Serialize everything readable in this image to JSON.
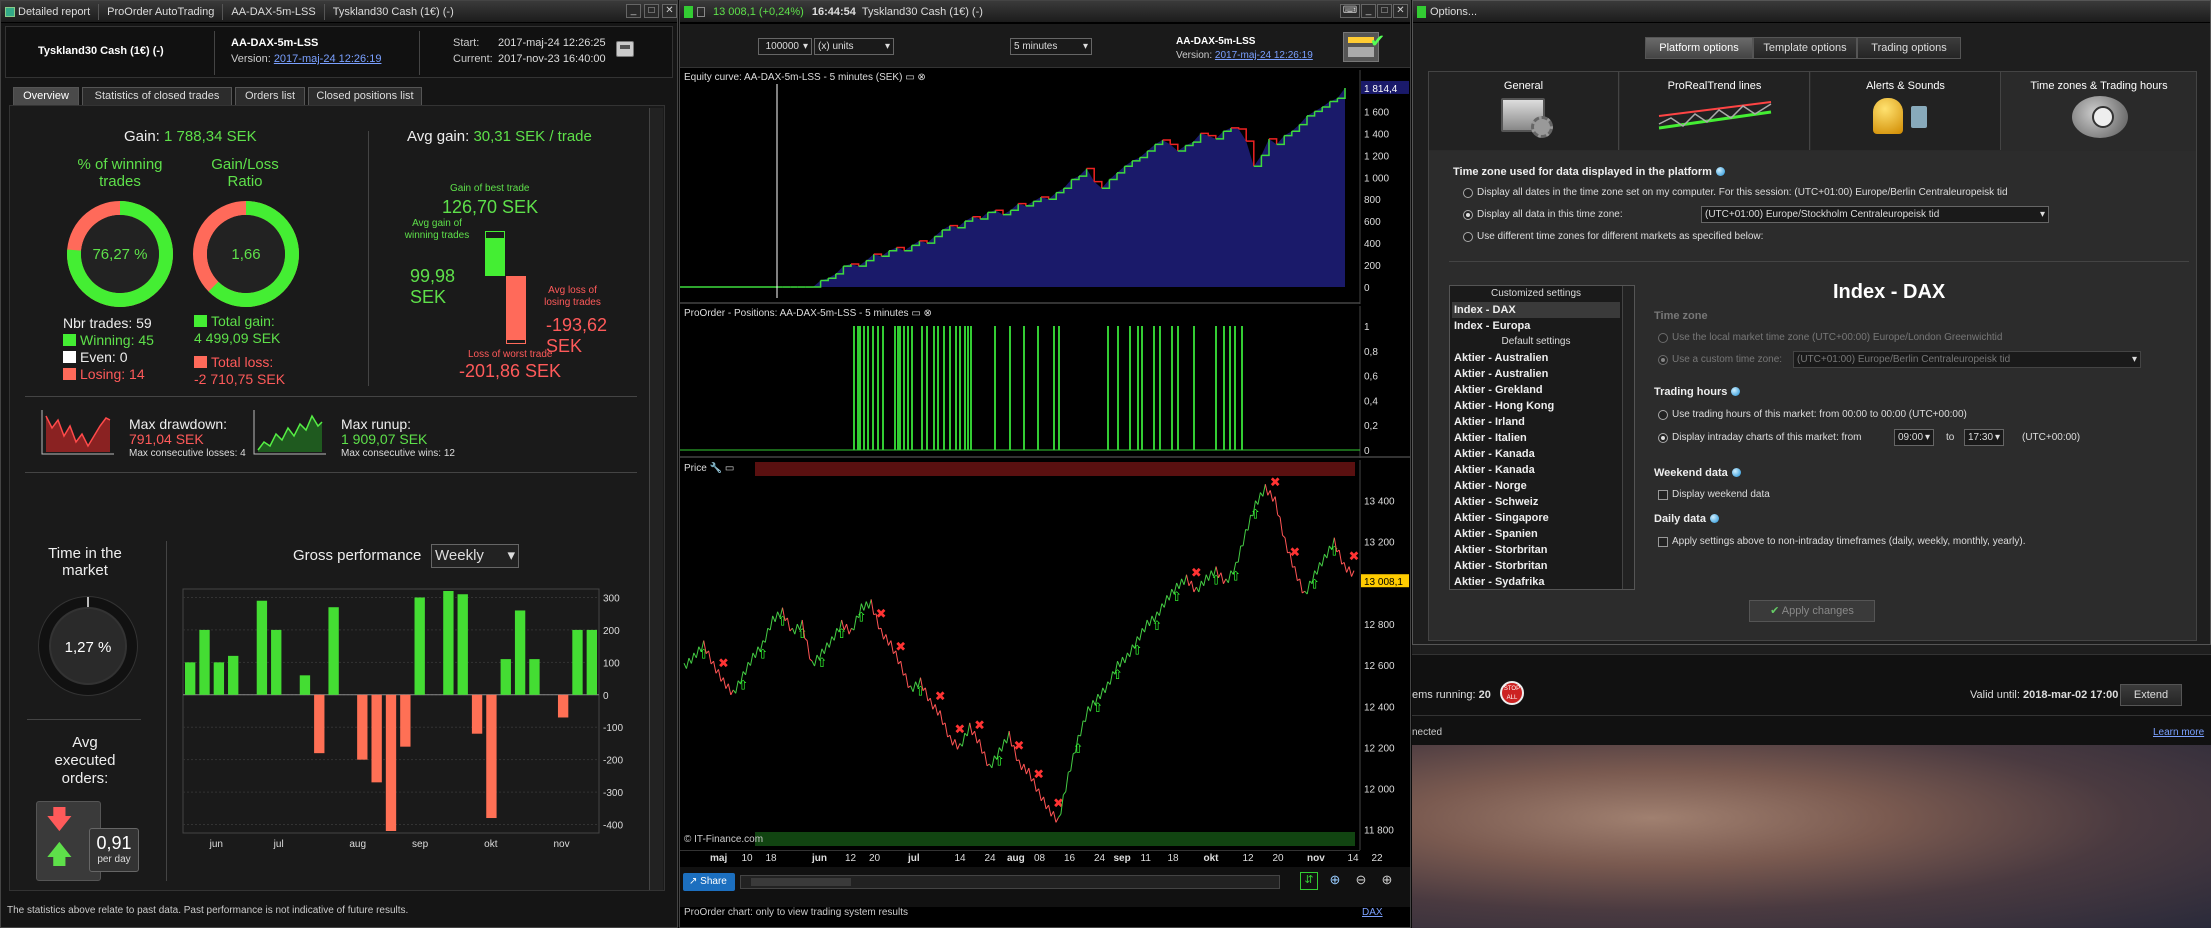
{
  "report": {
    "title_tabs": [
      "Detailed report",
      "ProOrder AutoTrading",
      "AA-DAX-5m-LSS",
      "Tyskland30 Cash (1€) (-)"
    ],
    "instrument": "Tyskland30 Cash (1€) (-)",
    "system_name": "AA-DAX-5m-LSS",
    "version_label": "Version:",
    "version_link": "2017-maj-24 12:26:19",
    "start_label": "Start:",
    "start_value": "2017-maj-24 12:26:25",
    "current_label": "Current:",
    "current_value": "2017-nov-23 16:40:00",
    "tabs": [
      "Overview",
      "Statistics of closed trades",
      "Orders list",
      "Closed positions list"
    ],
    "gain_label": "Gain:",
    "gain_value": "1 788,34 SEK",
    "avg_gain_label": "Avg gain:",
    "avg_gain_value": "30,31 SEK / trade",
    "pct_winning_label": "% of winning trades",
    "pct_winning_value": "76,27 %",
    "pct_winning_fraction": 0.7627,
    "gl_ratio_label": "Gain/Loss Ratio",
    "gl_ratio_value": "1,66",
    "gl_ratio_fraction": 0.624,
    "nbr_trades": "Nbr trades: 59",
    "winning": "Winning: 45",
    "even": "Even: 0",
    "losing": "Losing: 14",
    "total_gain_label": "Total gain:",
    "total_gain_value": "4 499,09 SEK",
    "total_loss_label": "Total loss:",
    "total_loss_value": "-2 710,75 SEK",
    "gain_best_label": "Gain of best trade",
    "gain_best_value": "126,70 SEK",
    "avg_gain_win_label": "Avg gain of winning trades",
    "avg_gain_win_value": "99,98 SEK",
    "avg_loss_label": "Avg loss of losing trades",
    "avg_loss_value": "-193,62 SEK",
    "loss_worst_label": "Loss of worst trade",
    "loss_worst_value": "-201,86 SEK",
    "max_drawdown_label": "Max drawdown:",
    "max_drawdown_value": "791,04 SEK",
    "max_consec_losses": "Max consecutive losses: 4",
    "max_runup_label": "Max runup:",
    "max_runup_value": "1 909,07 SEK",
    "max_consec_wins": "Max consecutive wins: 12",
    "time_in_market_label": "Time in the market",
    "time_in_market_value": "1,27 %",
    "avg_exec_label": "Avg executed orders:",
    "avg_exec_value": "0,91",
    "avg_exec_unit": "per day",
    "gross_perf_label": "Gross performance",
    "gross_perf_period": "Weekly",
    "footer": "The statistics above relate to past data. Past performance is not indicative of future results.",
    "colors": {
      "gain": "#5ee04a",
      "loss": "#ff5a5a",
      "bar_pos": "#44dd33",
      "bar_neg": "#ff7055"
    }
  },
  "gross_chart": {
    "type": "bar",
    "ylim": [
      -420,
      320
    ],
    "yticks": [
      300,
      200,
      100,
      0,
      -100,
      -200,
      -300,
      -400
    ],
    "xlabels": [
      "jun",
      "jul",
      "aug",
      "sep",
      "okt",
      "nov"
    ],
    "values": [
      100,
      200,
      100,
      120,
      0,
      290,
      200,
      0,
      60,
      -180,
      270,
      0,
      -200,
      -270,
      -420,
      -160,
      300,
      0,
      320,
      310,
      -120,
      -380,
      110,
      260,
      110,
      0,
      -70,
      200,
      200
    ]
  },
  "chart": {
    "top_price": "13 008,1 (+0,24%)",
    "time": "16:44:54",
    "instrument": "Tyskland30 Cash (1€) (-)",
    "units_value": "100000",
    "units_label": "(x) units",
    "interval": "5 minutes",
    "system_name": "AA-DAX-5m-LSS",
    "version_label": "Version:",
    "version_link": "2017-maj-24 12:26:19",
    "equity_title": "Equity curve: AA-DAX-5m-LSS - 5 minutes (SEK)",
    "equity_last": "1 814,4",
    "equity_yticks": [
      "1 600",
      "1 400",
      "1 200",
      "1 000",
      "800",
      "600",
      "400",
      "200",
      "0"
    ],
    "positions_title": "ProOrder - Positions: AA-DAX-5m-LSS - 5 minutes",
    "positions_yticks": [
      "1",
      "0,8",
      "0,6",
      "0,4",
      "0,2",
      "0"
    ],
    "price_title": "Price",
    "price_last": "13 008,1",
    "price_yticks": [
      "13 400",
      "13 200",
      "13 000",
      "12 800",
      "12 600",
      "12 400",
      "12 200",
      "12 000",
      "11 800"
    ],
    "xlabels": [
      "maj",
      "10",
      "18",
      "jun",
      "12",
      "20",
      "jul",
      "14",
      "24",
      "aug",
      "08",
      "16",
      "24",
      "sep",
      "11",
      "18",
      "okt",
      "12",
      "20",
      "nov",
      "14",
      "22"
    ],
    "copyright": "© IT-Finance.com",
    "share_label": "Share",
    "footer": "ProOrder chart: only to view trading system results",
    "footer_link": "DAX",
    "equity_series": [
      0,
      0,
      0,
      0,
      0,
      0,
      60,
      80,
      120,
      190,
      210,
      190,
      240,
      300,
      280,
      330,
      360,
      330,
      380,
      420,
      400,
      460,
      520,
      560,
      540,
      600,
      640,
      620,
      680,
      700,
      660,
      700,
      760,
      740,
      780,
      820,
      800,
      860,
      900,
      980,
      1010,
      1080,
      960,
      900,
      980,
      1040,
      1100,
      1150,
      1180,
      1240,
      1300,
      1340,
      1300,
      1240,
      1290,
      1320,
      1400,
      1380,
      1350,
      1420,
      1450,
      1440,
      1330,
      1100,
      1200,
      1350,
      1300,
      1380,
      1420,
      1480,
      1560,
      1600,
      1640,
      1690,
      1720,
      1814
    ],
    "price_series": [
      12590,
      12640,
      12700,
      12600,
      12520,
      12460,
      12550,
      12640,
      12700,
      12820,
      12860,
      12760,
      12800,
      12600,
      12660,
      12720,
      12800,
      12760,
      12880,
      12900,
      12760,
      12700,
      12600,
      12480,
      12520,
      12420,
      12360,
      12240,
      12200,
      12300,
      12220,
      12100,
      12180,
      12260,
      12120,
      12080,
      11980,
      11900,
      11840,
      12060,
      12240,
      12380,
      12440,
      12500,
      12600,
      12640,
      12720,
      12800,
      12840,
      12920,
      12980,
      13020,
      12960,
      13020,
      13060,
      13000,
      13080,
      13240,
      13380,
      13460,
      13400,
      13200,
      13060,
      12940,
      13040,
      13120,
      13200,
      13080,
      13040
    ],
    "position_lines": [
      74,
      78,
      80,
      84,
      88,
      93,
      98,
      103,
      115,
      118,
      120,
      124,
      128,
      132,
      142,
      147,
      154,
      158,
      164,
      170,
      176,
      180,
      185,
      188,
      191,
      215,
      230,
      244,
      258,
      274,
      279,
      328,
      338,
      350,
      358,
      362,
      374,
      380,
      392,
      398,
      414,
      436,
      444,
      450,
      455,
      462
    ]
  },
  "options": {
    "title": "Options...",
    "top_tabs": [
      "Platform options",
      "Template options",
      "Trading options"
    ],
    "categories": [
      "General",
      "ProRealTrend lines",
      "Alerts & Sounds",
      "Time zones & Trading hours"
    ],
    "tz_heading": "Time zone used for data displayed in the platform",
    "tz_opt1": "Display all dates in the time zone set on my computer. For this session:  (UTC+01:00) Europe/Berlin Centraleuropeisk tid",
    "tz_opt2": "Display all data in this time zone:",
    "tz_opt2_value": "(UTC+01:00) Europe/Stockholm Centraleuropeisk tid",
    "tz_opt3": "Use different time zones for different markets as specified below:",
    "list_header_custom": "Customized settings",
    "list_custom": [
      "Index - DAX",
      "Index - Europa"
    ],
    "list_header_default": "Default settings",
    "list_default": [
      "Aktier - Australien",
      "Aktier - Australien",
      "Aktier - Grekland",
      "Aktier - Hong Kong",
      "Aktier - Irland",
      "Aktier - Italien",
      "Aktier - Kanada",
      "Aktier - Kanada",
      "Aktier - Norge",
      "Aktier - Schweiz",
      "Aktier - Singapore",
      "Aktier - Spanien",
      "Aktier - Storbritan",
      "Aktier - Storbritan",
      "Aktier - Sydafrika"
    ],
    "market_title": "Index - DAX",
    "tz_label": "Time zone",
    "tz_local": "Use the local market time zone (UTC+00:00) Europe/London Greenwichtid",
    "tz_custom": "Use a custom time zone:",
    "tz_custom_value": "(UTC+01:00) Europe/Berlin Centraleuropeisk tid",
    "trading_hours_label": "Trading hours",
    "th_opt1": "Use trading hours of this market:  from 00:00 to 00:00  (UTC+00:00)",
    "th_opt2": "Display intraday charts of this market:   from",
    "th_from": "09:00",
    "th_to_label": "to",
    "th_to": "17:30",
    "th_tz": "(UTC+00:00)",
    "weekend_label": "Weekend data",
    "weekend_opt": "Display weekend data",
    "daily_label": "Daily data",
    "daily_opt": "Apply settings above to non-intraday timeframes (daily, weekly, monthly, yearly).",
    "apply": "Apply changes"
  },
  "bottom_right": {
    "items_running_label": "ems running:",
    "items_running_value": "20",
    "stop_label": "STOP ALL",
    "valid_until_label": "Valid until:",
    "valid_until_value": "2018-mar-02 17:00",
    "extend": "Extend",
    "connected": "nected",
    "learn_more": "Learn more"
  }
}
